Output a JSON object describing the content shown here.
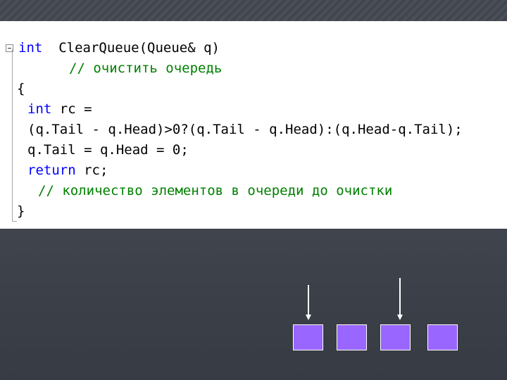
{
  "code": {
    "line1": {
      "kw": "int",
      "text": "  ClearQueue(Queue& q)"
    },
    "line2": {
      "comment": "// очистить очередь"
    },
    "line3": {
      "text": "{"
    },
    "line4": {
      "kw": "int",
      "text": " rc ="
    },
    "line5": {
      "text": "(q.Tail - q.Head)>0?(q.Tail - q.Head):(q.Head-q.Tail);"
    },
    "line6": {
      "text": "q.Tail = q.Head = 0;"
    },
    "line7": {
      "kw": "return",
      "text": " rc;"
    },
    "line8": {
      "comment": "// количество элементов в очереди до очистки"
    },
    "line9": {
      "text": "}"
    }
  },
  "colors": {
    "keyword": "#0000ff",
    "comment": "#008000",
    "queue_cell": "#9966ff",
    "background": "#3e434c"
  },
  "diagram": {
    "cell_count": 4,
    "pointer_count": 2
  }
}
